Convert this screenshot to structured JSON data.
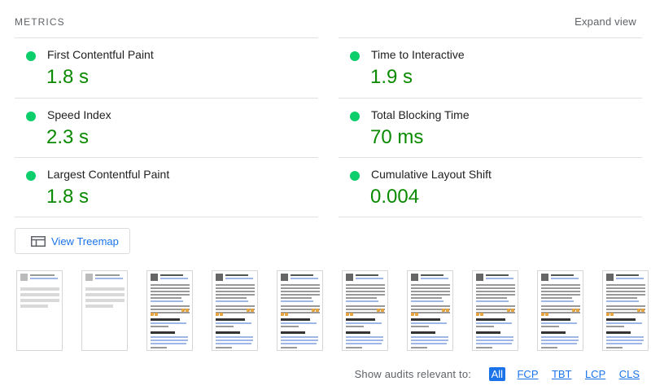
{
  "header": {
    "title": "METRICS",
    "expand_label": "Expand view"
  },
  "metrics": [
    {
      "label": "First Contentful Paint",
      "value": "1.8 s",
      "status_color": "#0cce6b"
    },
    {
      "label": "Time to Interactive",
      "value": "1.9 s",
      "status_color": "#0cce6b"
    },
    {
      "label": "Speed Index",
      "value": "2.3 s",
      "status_color": "#0cce6b"
    },
    {
      "label": "Total Blocking Time",
      "value": "70 ms",
      "status_color": "#0cce6b"
    },
    {
      "label": "Largest Contentful Paint",
      "value": "1.8 s",
      "status_color": "#0cce6b"
    },
    {
      "label": "Cumulative Layout Shift",
      "value": "0.004",
      "status_color": "#0cce6b"
    }
  ],
  "treemap": {
    "label": "View Treemap",
    "icon": "treemap-icon"
  },
  "filmstrip": {
    "frame_count": 10
  },
  "filters": {
    "label": "Show audits relevant to:",
    "options": [
      "All",
      "FCP",
      "TBT",
      "LCP",
      "CLS"
    ],
    "active": "All"
  },
  "colors": {
    "good_value": "#0a8a00",
    "link": "#1a73e8"
  }
}
